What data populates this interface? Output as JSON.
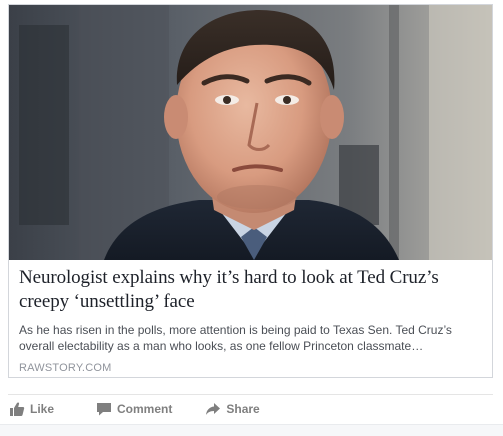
{
  "link_preview": {
    "image_alt": "Ted Cruz",
    "headline": "Neurologist explains why it’s hard to look at Ted Cruz’s creepy ‘unsettling’ face",
    "description": "As he has risen in the polls, more attention is being paid to Texas Sen. Ted Cruz’s overall electability as a man who looks, as one fellow Princeton classmate…",
    "domain": "RAWSTORY.COM"
  },
  "actions": {
    "like_label": "Like",
    "comment_label": "Comment",
    "share_label": "Share"
  },
  "icons": {
    "like": "thumbs-up-icon",
    "comment": "speech-bubble-icon",
    "share": "share-arrow-icon"
  },
  "colors": {
    "headline": "#1d2129",
    "description": "#4b4f56",
    "domain": "#90949c",
    "action_text": "#7f7f7f",
    "card_border": "#d3d6db"
  }
}
